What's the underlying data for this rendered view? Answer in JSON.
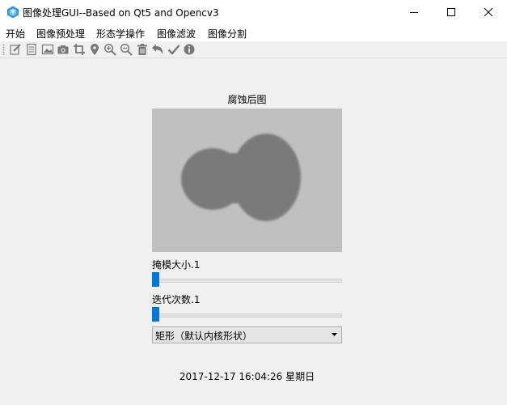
{
  "window": {
    "title": "图像处理GUI--Based on Qt5 and Opencv3",
    "minimize": "minimize",
    "maximize": "maximize",
    "close": "close"
  },
  "menu": {
    "items": [
      "开始",
      "图像预处理",
      "形态学操作",
      "图像滤波",
      "图像分割"
    ]
  },
  "toolbar": {
    "icons": [
      "edit-icon",
      "document-icon",
      "image-icon",
      "camera-icon",
      "crop-icon",
      "location-pin-icon",
      "zoom-in-icon",
      "zoom-out-icon",
      "trash-icon",
      "undo-icon",
      "checkmark-icon",
      "info-icon"
    ]
  },
  "main": {
    "image_title": "腐蚀后图",
    "kernel_size_label": "掩模大小.1",
    "kernel_size_value": 1,
    "iterations_label": "迭代次数.1",
    "iterations_value": 1,
    "kernel_shape": "矩形（默认内核形状）",
    "datetime": "2017-12-17 16:04:26 星期日"
  },
  "colors": {
    "accent": "#0078d7",
    "image_background": "#c0c0c0",
    "blob": "#7a7a7a"
  }
}
